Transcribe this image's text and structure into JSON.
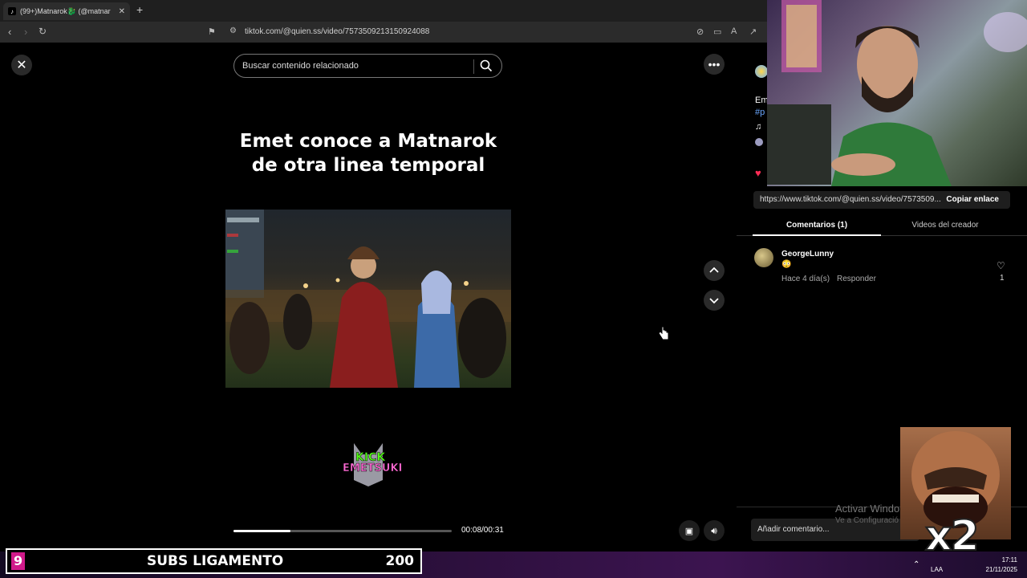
{
  "browser": {
    "tab_title": "(99+)Matnarok🐉 (@matnar",
    "tab_close": "✕",
    "new_tab": "+",
    "url": "tiktok.com/@quien.ss/video/7573509213150924088"
  },
  "page": {
    "search_placeholder": "Buscar contenido relacionado",
    "video_title_line1": "Emet conoce a Matnarok",
    "video_title_line2": "de otra linea temporal",
    "logo_line1": "KICK",
    "logo_line2": "EMETSUKI",
    "progress_fraction": 0.26,
    "time": "00:08/00:31"
  },
  "panel": {
    "partial_lines": [
      "Em",
      "#p",
      "♫"
    ],
    "share_link": "https://www.tiktok.com/@quien.ss/video/7573509...",
    "copy_link": "Copiar enlace",
    "tab_comments": "Comentarios (1)",
    "tab_creator": "Videos del creador",
    "comment": {
      "author": "GeorgeLunny",
      "emoji": "😳",
      "age": "Hace 4 día(s)",
      "reply": "Responder",
      "likes": "1"
    },
    "add_comment_placeholder": "Añadir comentario..."
  },
  "windows_watermark": {
    "line1": "Activar Windo",
    "line2": "Ve a Configuració"
  },
  "overlay": {
    "multiplier": "x2",
    "subs_count_badge": "9",
    "subs_label": "SUBS LIGAMENTO",
    "subs_value": "200"
  },
  "tray": {
    "lang": "LAA",
    "time": "17:11",
    "date": "21/11/2025"
  },
  "colors": {
    "accent_heart": "#fe2c55",
    "stream_badge": "#d01a8a"
  }
}
